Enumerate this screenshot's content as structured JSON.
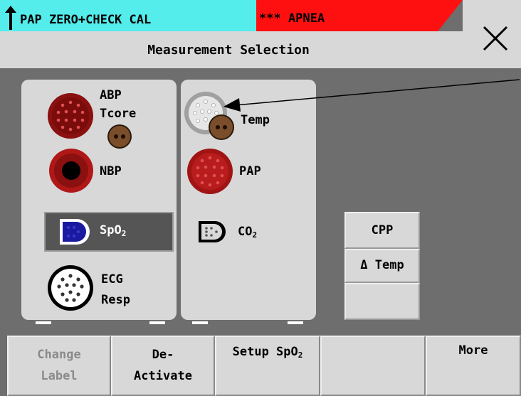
{
  "alarms": {
    "inop_text": "PAP ZERO+CHECK CAL",
    "inop_color": "#55ecec",
    "alarm_text": "*** APNEA",
    "alarm_color": "#ff1010"
  },
  "header": {
    "title": "Measurement Selection",
    "close_icon": "close-icon"
  },
  "module_left": {
    "abp_tcore_label_1": "ABP",
    "abp_tcore_label_2": "Tcore",
    "nbp_label": "NBP",
    "spo2_label": "SpO",
    "spo2_sub": "2",
    "ecg_label_1": "ECG",
    "ecg_label_2": "Resp"
  },
  "module_right": {
    "temp_label": "Temp",
    "pap_label": "PAP",
    "co2_label": "CO",
    "co2_sub": "2"
  },
  "calc_buttons": {
    "cpp_label": "CPP",
    "delta_temp_label": "Δ Temp",
    "empty_label": ""
  },
  "softkeys": {
    "change_label_1": "Change",
    "change_label_2": "Label",
    "deactivate_1": "De-",
    "deactivate_2": "Activate",
    "setup_label": "Setup SpO",
    "setup_sub": "2",
    "empty": "",
    "more": "More"
  },
  "colors": {
    "connector_red": "#8b1010",
    "connector_brown": "#7a4e2a",
    "connector_blue": "#1a1aa0",
    "panel_grey": "#d8d8d8",
    "background_grey": "#6e6e6e"
  }
}
